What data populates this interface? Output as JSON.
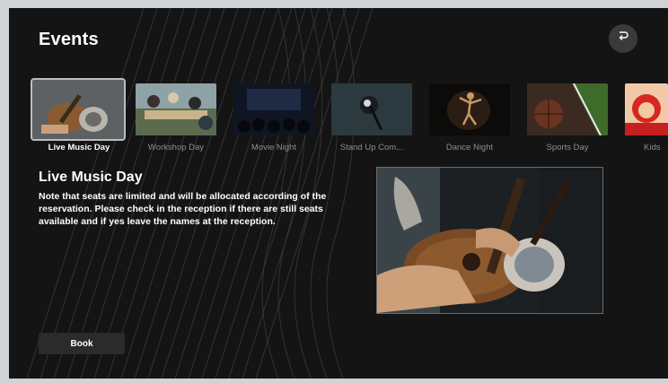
{
  "header": {
    "title": "Events"
  },
  "events": [
    {
      "label": "Live Music Day"
    },
    {
      "label": "Workshop Day"
    },
    {
      "label": "Movie Night"
    },
    {
      "label": "Stand Up Com..."
    },
    {
      "label": "Dance Night"
    },
    {
      "label": "Sports Day"
    },
    {
      "label": "Kids"
    }
  ],
  "selected_event": {
    "title": "Live Music Day",
    "description": "Note that seats are limited and will be allocated according of the reservation. Please check in the reception if there are still seats available and if yes leave the names at the reception."
  },
  "actions": {
    "book_label": "Book"
  },
  "icons": {
    "back": "return-arrow-icon"
  }
}
